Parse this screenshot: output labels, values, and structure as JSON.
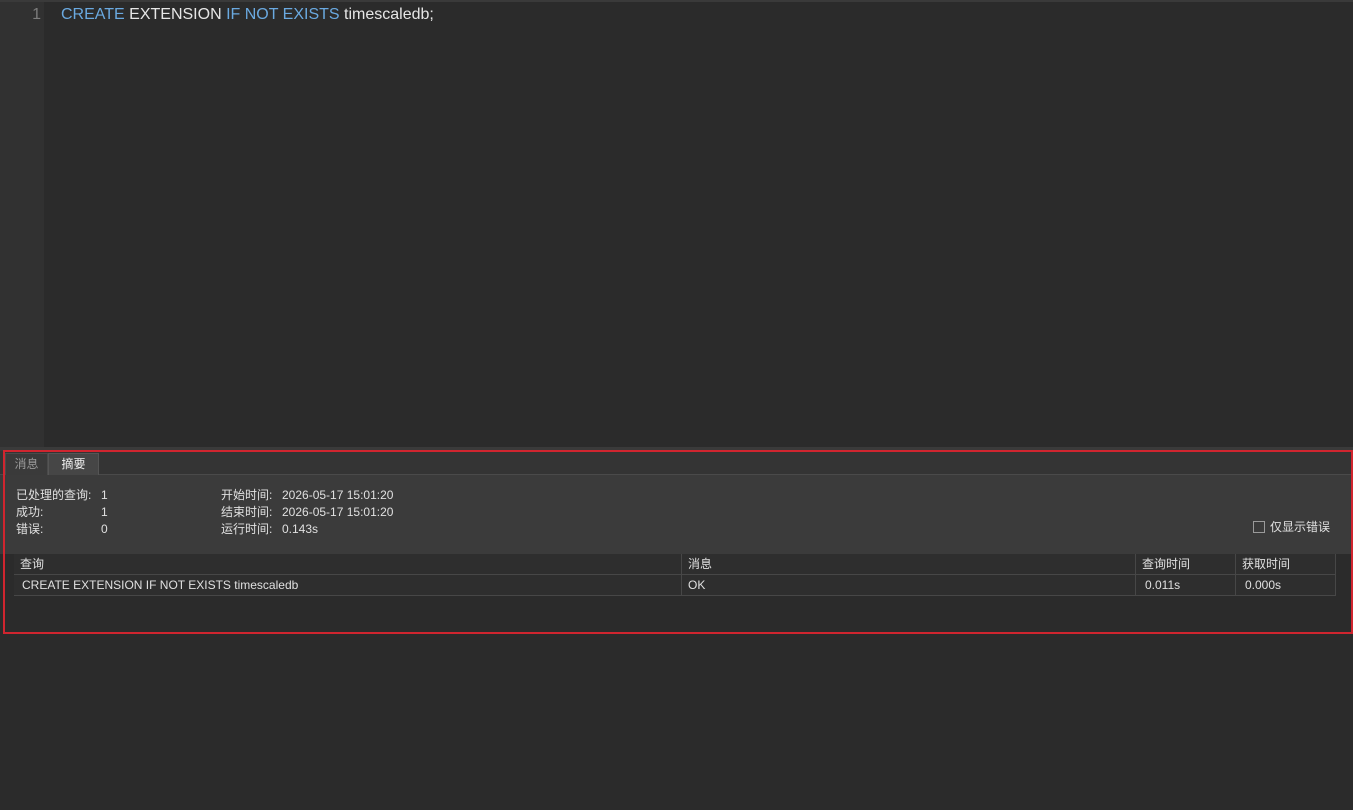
{
  "editor": {
    "line_number": "1",
    "code": [
      {
        "text": "CREATE",
        "kind": "kw"
      },
      {
        "text": " EXTENSION ",
        "kind": "plain"
      },
      {
        "text": "IF NOT EXISTS",
        "kind": "kw"
      },
      {
        "text": " timescaledb;",
        "kind": "plain"
      }
    ]
  },
  "tabs": [
    {
      "label": "消息"
    },
    {
      "label": "摘要"
    }
  ],
  "summary": {
    "processed_label": "已处理的查询:",
    "processed_value": "1",
    "success_label": "成功:",
    "success_value": "1",
    "error_label": "错误:",
    "error_value": "0",
    "start_label": "开始时间:",
    "start_value": "2026-05-17 15:01:20",
    "end_label": "结束时间:",
    "end_value": "2026-05-17 15:01:20",
    "runtime_label": "运行时间:",
    "runtime_value": "0.143s",
    "errors_only_label": "仅显示错误"
  },
  "table": {
    "headers": [
      "查询",
      "消息",
      "查询时间",
      "获取时间"
    ],
    "rows": [
      [
        "CREATE EXTENSION IF NOT EXISTS timescaledb",
        "OK",
        "0.011s",
        "0.000s"
      ]
    ]
  },
  "colors": {
    "highlight_border": "#d0252f",
    "keyword": "#6aa9e0"
  }
}
